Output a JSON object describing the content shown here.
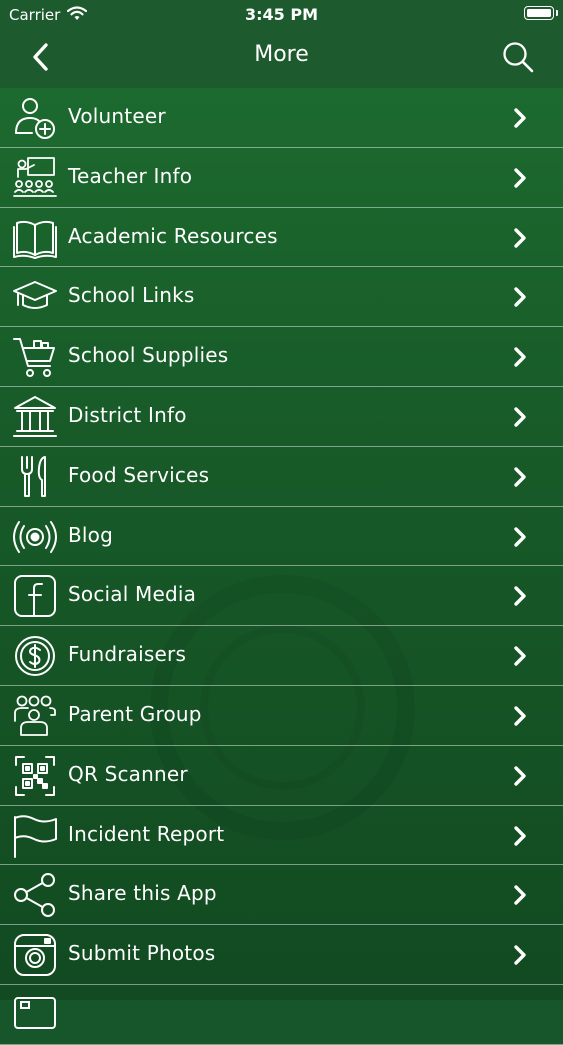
{
  "status_bar": {
    "carrier": "Carrier",
    "time": "3:45 PM",
    "icons": [
      "wifi-icon",
      "battery-icon"
    ]
  },
  "nav": {
    "title": "More",
    "left_icon": "back-chevron-icon",
    "right_icon": "search-icon"
  },
  "colors": {
    "header": "#1d5a2d",
    "background": "#185c29",
    "text": "#ffffff",
    "divider": "#a8c4ae"
  },
  "menu": {
    "items": [
      {
        "label": "Volunteer",
        "icon": "volunteer-icon"
      },
      {
        "label": "Teacher Info",
        "icon": "teacher-icon"
      },
      {
        "label": "Academic Resources",
        "icon": "book-icon"
      },
      {
        "label": "School Links",
        "icon": "graduation-cap-icon"
      },
      {
        "label": "School Supplies",
        "icon": "shopping-cart-icon"
      },
      {
        "label": "District Info",
        "icon": "building-icon"
      },
      {
        "label": "Food Services",
        "icon": "fork-knife-icon"
      },
      {
        "label": "Blog",
        "icon": "broadcast-icon"
      },
      {
        "label": "Social Media",
        "icon": "facebook-icon"
      },
      {
        "label": "Fundraisers",
        "icon": "dollar-coin-icon"
      },
      {
        "label": "Parent Group",
        "icon": "group-icon"
      },
      {
        "label": "QR Scanner",
        "icon": "qr-code-icon"
      },
      {
        "label": "Incident Report",
        "icon": "flag-icon"
      },
      {
        "label": "Share this App",
        "icon": "share-icon"
      },
      {
        "label": "Submit Photos",
        "icon": "camera-icon"
      }
    ]
  }
}
